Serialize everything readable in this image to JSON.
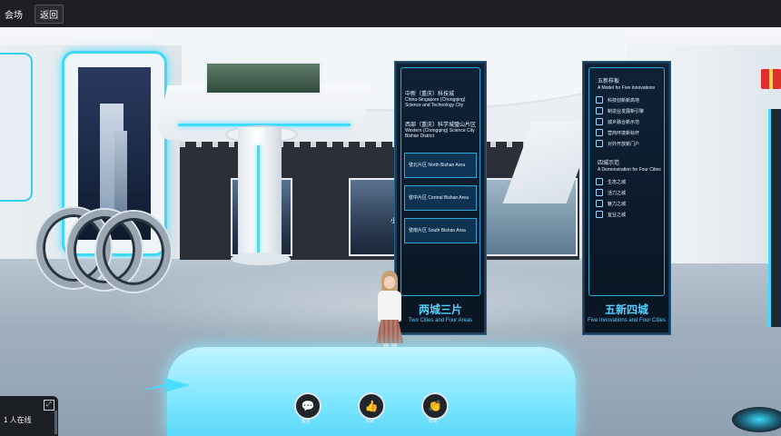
{
  "topbar": {
    "menu_label": "会场",
    "back_label": "返回"
  },
  "panel_left": {
    "header_cn_1": "中新（重庆）科技城",
    "header_en_1": "China-Singapore (Chongqing) Science and Technology City",
    "header_cn_2": "西部（重庆）科学城璧山片区",
    "header_en_2": "Western (Chongqing) Science City Bishan District",
    "areas": [
      {
        "label": "璧北片区 North Bishan Area"
      },
      {
        "label": "璧中片区 Central Bishan Area"
      },
      {
        "label": "璧南片区 South Bishan Area"
      }
    ],
    "footer_cn": "两城三片",
    "footer_en": "Two Cities and Four Areas"
  },
  "panel_right": {
    "section1_cn": "五新样板",
    "section1_en": "A Model for Five Innovations",
    "section1_items": [
      "科技创新新高地",
      "制造业发展新引擎",
      "城乡融合新示范",
      "营商环境新标杆",
      "对外开放新门户"
    ],
    "section2_cn": "四城示范",
    "section2_en": "A Demonstration for Four Cities",
    "section2_items": [
      "生态之城",
      "活力之城",
      "魅力之城",
      "宜业之城"
    ],
    "footer_cn": "五新四城",
    "footer_en": "Five Innovations and Four Cities"
  },
  "backwall": {
    "sign_text": "小元"
  },
  "controls": [
    {
      "icon": "chat-icon",
      "glyph": "💬",
      "label": "留言"
    },
    {
      "icon": "thumbs-up-icon",
      "glyph": "👍",
      "label": "点赞"
    },
    {
      "icon": "clap-icon",
      "glyph": "👏",
      "label": "鼓掌"
    }
  ],
  "online": {
    "count_text": "1 人在线"
  },
  "colors": {
    "accent_cyan": "#3fdcff",
    "panel_bg": "#0f2236",
    "topbar_bg": "#1e1f22"
  }
}
